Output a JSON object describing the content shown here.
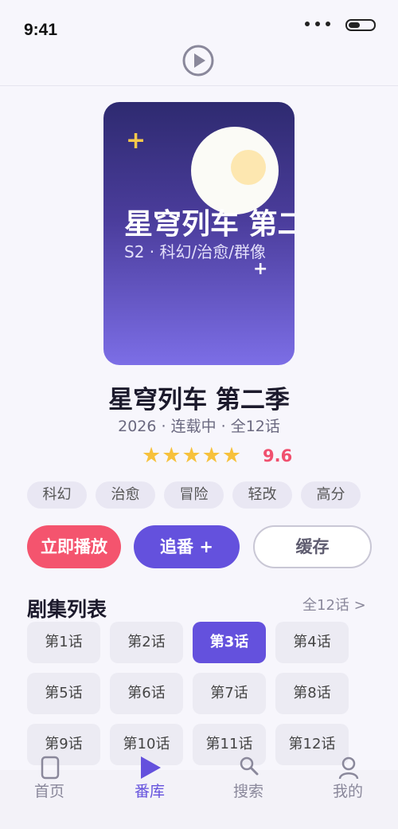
{
  "status_bar": {
    "time": "9:41"
  },
  "header": {
    "icon": "play-circle-icon"
  },
  "cover": {
    "title": "星穹列车 第二季",
    "subtitle": "S2 · 科幻/治愈/群像"
  },
  "show": {
    "title": "星穹列车 第二季",
    "meta": "2026 · 连载中 · 全12话",
    "stars": [
      "★",
      "★",
      "★",
      "★",
      "★"
    ],
    "rating": "9.6",
    "tags": [
      "科幻",
      "治愈",
      "冒险",
      "轻改",
      "高分"
    ]
  },
  "actions": {
    "play": "立即播放",
    "follow": "追番 +",
    "cache": "缓存"
  },
  "episodes": {
    "heading": "剧集列表",
    "all_link": "全12话 >",
    "items": [
      "第1话",
      "第2话",
      "第3话",
      "第4话",
      "第5话",
      "第6话",
      "第7话",
      "第8话",
      "第9话",
      "第10话",
      "第11话",
      "第12话"
    ],
    "active": "第3话"
  },
  "nav": {
    "items": [
      {
        "label": "首页",
        "icon": "phone-icon"
      },
      {
        "label": "番库",
        "icon": "play-triangle-icon"
      },
      {
        "label": "搜索",
        "icon": "search-icon"
      },
      {
        "label": "我的",
        "icon": "user-icon"
      }
    ],
    "active": "番库"
  },
  "colors": {
    "accent": "#6451dd",
    "play_button": "#f4546e",
    "star": "#f7c13b",
    "rating": "#f0506e"
  }
}
